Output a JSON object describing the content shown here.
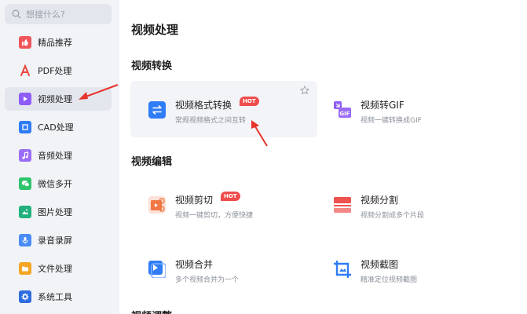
{
  "search": {
    "placeholder": "想搜什么?"
  },
  "sidebar": {
    "items": [
      {
        "label": "精品推荐",
        "icon": "thumbs-up-icon",
        "color": "#f0555a"
      },
      {
        "label": "PDF处理",
        "icon": "pdf-icon",
        "color": "#e8453c"
      },
      {
        "label": "视频处理",
        "icon": "play-icon",
        "color": "#8e5cf7",
        "active": true
      },
      {
        "label": "CAD处理",
        "icon": "cad-icon",
        "color": "#2f7cf6"
      },
      {
        "label": "音频处理",
        "icon": "music-icon",
        "color": "#9b6cf7"
      },
      {
        "label": "微信多开",
        "icon": "wechat-icon",
        "color": "#2ec46d"
      },
      {
        "label": "图片处理",
        "icon": "image-icon",
        "color": "#22b07d"
      },
      {
        "label": "录音录屏",
        "icon": "mic-icon",
        "color": "#4a8cf7"
      },
      {
        "label": "文件处理",
        "icon": "folder-icon",
        "color": "#f5a524"
      },
      {
        "label": "系统工具",
        "icon": "gear-icon",
        "color": "#2d6cdf"
      }
    ]
  },
  "main": {
    "title": "视频处理",
    "sections": [
      {
        "title": "视频转换",
        "tools": [
          {
            "name": "视频格式转换",
            "desc": "常规视频格式之间互转",
            "hot": "HOT",
            "icon": "convert-icon"
          },
          {
            "name": "视频转GIF",
            "desc": "视频一键转换成GIF",
            "icon": "gif-icon"
          }
        ]
      },
      {
        "title": "视频编辑",
        "tools": [
          {
            "name": "视频剪切",
            "desc": "视频一键剪切，方便快捷",
            "hot": "HOT",
            "icon": "cut-icon"
          },
          {
            "name": "视频分割",
            "desc": "视频分割成多个片段",
            "icon": "split-icon"
          },
          {
            "name": "视频合并",
            "desc": "多个视频合并为一个",
            "icon": "merge-icon"
          },
          {
            "name": "视频截图",
            "desc": "精准定位视频截图",
            "icon": "crop-icon"
          }
        ]
      }
    ],
    "next_section_partial": "视频调整"
  },
  "colors": {
    "accent": "#2f7cf6",
    "hot": "#f04c4c",
    "annotation_arrow": "#e8332d"
  }
}
